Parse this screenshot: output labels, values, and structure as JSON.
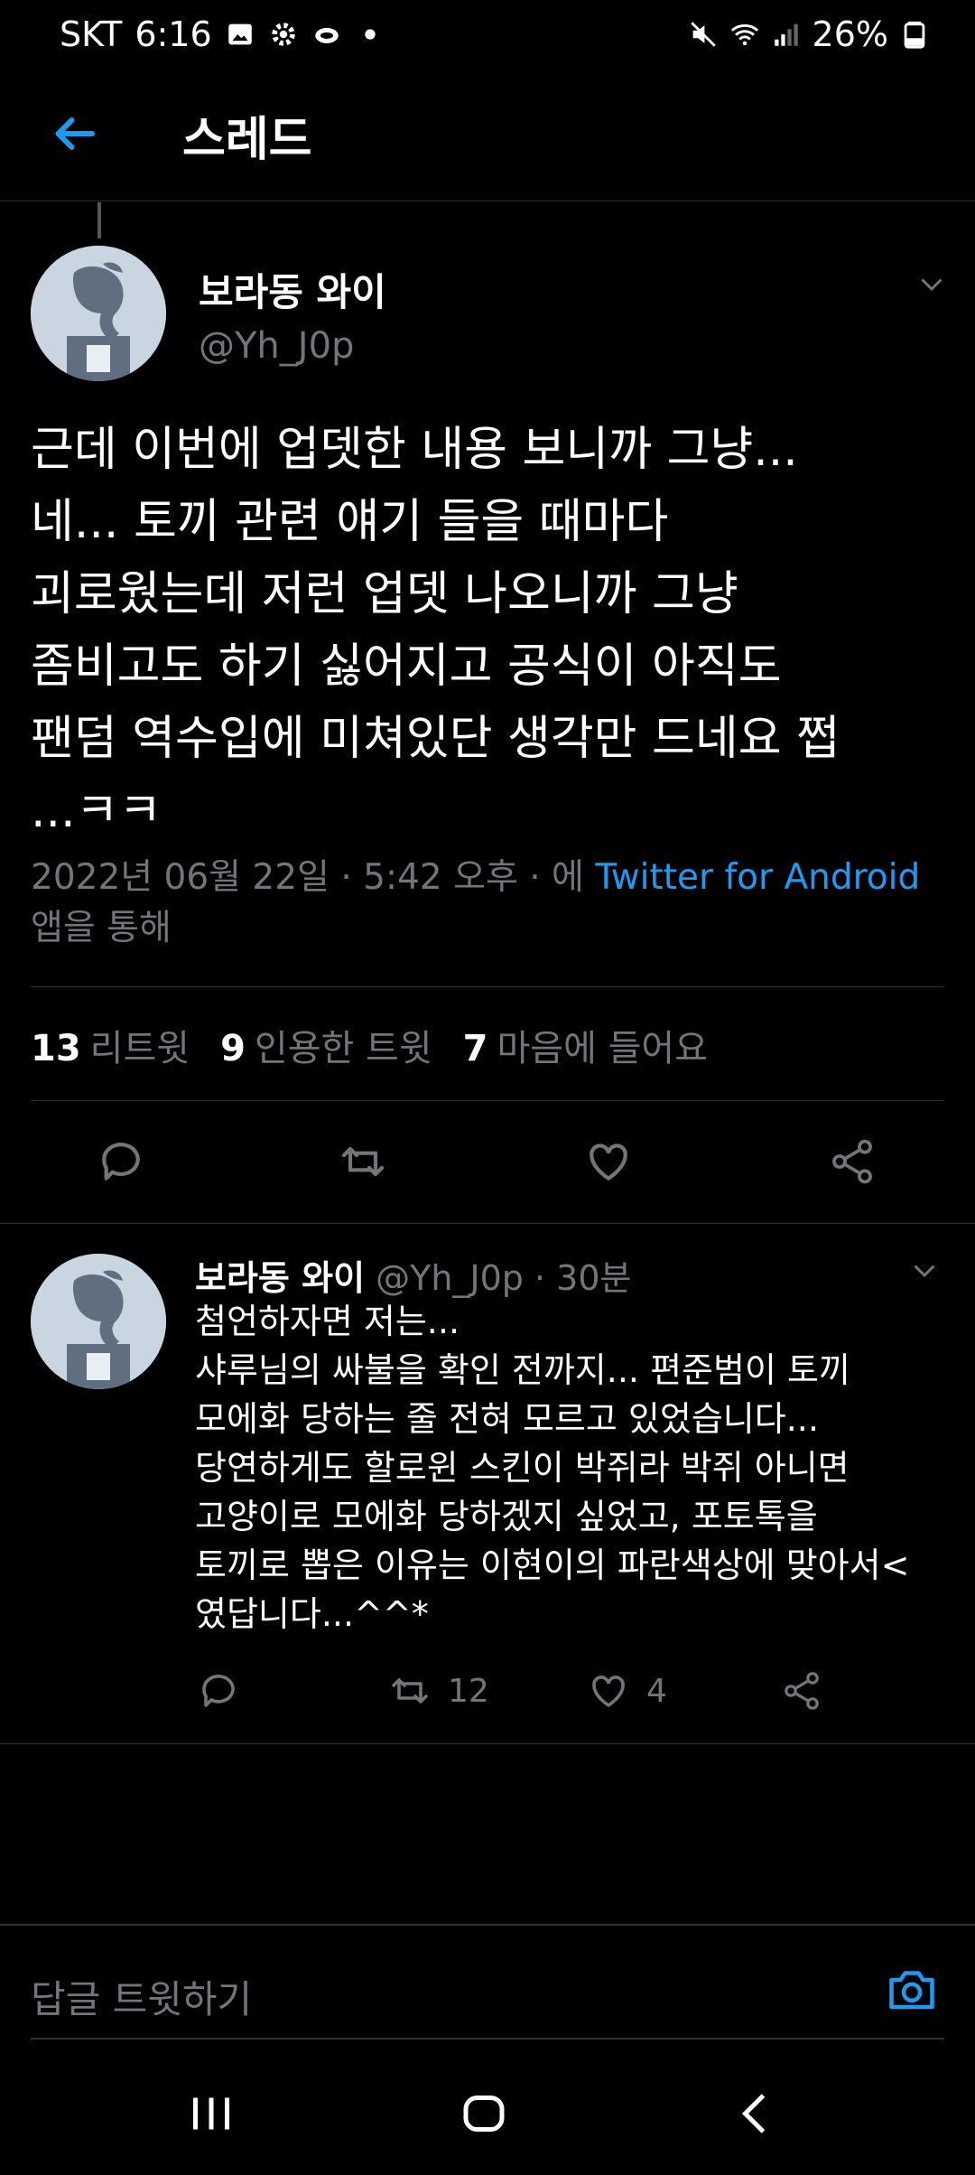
{
  "status_bar": {
    "carrier": "SKT",
    "time": "6:16",
    "battery": "26%",
    "icons": [
      "image-icon",
      "gear-icon",
      "cloud-icon",
      "dot-icon",
      "mute-icon",
      "wifi-icon",
      "signal-icon",
      "battery-icon"
    ]
  },
  "header": {
    "title": "스레드",
    "back_icon": "back-arrow-icon"
  },
  "main_tweet": {
    "display_name": "보라동 와이",
    "handle": "@Yh_J0p",
    "text": "근데 이번에 업뎃한 내용 보니까 그냥...\n네... 토끼 관련 얘기 들을 때마다\n괴로웠는데 저런 업뎃 나오니까 그냥\n좀비고도 하기 싫어지고 공식이 아직도\n팬덤 역수입에 미쳐있단 생각만 드네요 쩝\n...ㅋㅋ",
    "timestamp": "2022년 06월 22일 · 5:42 오후 · 에 ",
    "source": "Twitter for Android",
    "via": "앱을 통해",
    "stats": [
      {
        "count": "13",
        "label": "리트윗"
      },
      {
        "count": "9",
        "label": "인용한 트윗"
      },
      {
        "count": "7",
        "label": "마음에 들어요"
      }
    ]
  },
  "reply": {
    "display_name": "보라동 와이",
    "handle_time": "@Yh_J0p · 30분",
    "text": "첨언하자면 저는...\n샤루님의 싸불을 확인 전까지... 편준범이 토끼\n모에화 당하는 줄 전혀 모르고 있었습니다...\n당연하게도 할로윈 스킨이 박쥐라 박쥐 아니면\n고양이로 모에화 당하겠지 싶었고, 포토톡을\n토끼로 뽑은 이유는 이현이의 파란색상에 맞아서<\n였답니다...^^*",
    "retweets": "12",
    "likes": "4"
  },
  "composer": {
    "placeholder": "답글 트윗하기"
  },
  "colors": {
    "accent": "#1d9bf0",
    "muted": "#71767b",
    "background": "#000000",
    "text": "#e7e9ea"
  }
}
